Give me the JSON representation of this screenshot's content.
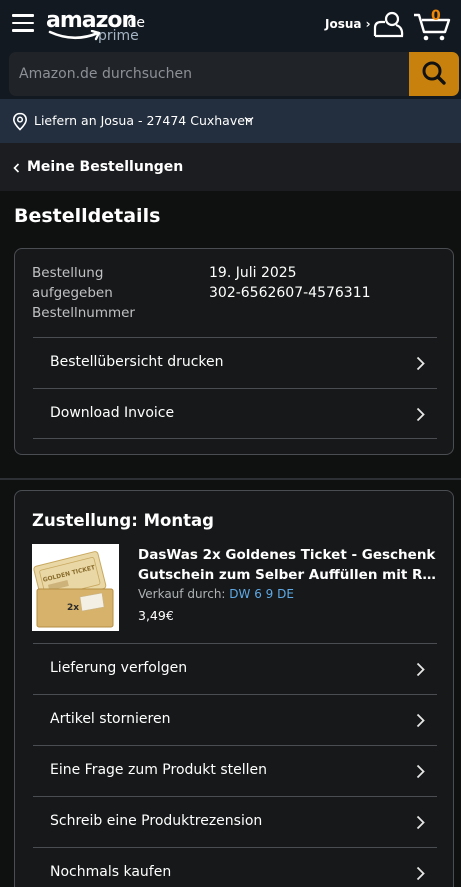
{
  "header": {
    "logo_text": "amazon",
    "logo_domain": ".de",
    "logo_sub": "prime",
    "account_label": "Josua ›",
    "cart_count": "0",
    "accent_color": "#c7810c"
  },
  "search": {
    "placeholder": "Amazon.de durchsuchen"
  },
  "delivery_bar": {
    "text": "Liefern an Josua - 27474 Cuxhaven"
  },
  "breadcrumb": {
    "label": "Meine Bestellungen"
  },
  "page": {
    "title": "Bestelldetails"
  },
  "order": {
    "placed_label_1": "Bestellung",
    "placed_label_2": "aufgegeben",
    "placed_value": "19. Juli 2025",
    "number_label": "Bestellnummer",
    "number_value": "302-6562607-4576311",
    "links": [
      "Bestellübersicht drucken",
      "Download Invoice"
    ]
  },
  "shipment": {
    "title": "Zustellung: Montag",
    "product_title_1": "DasWas 2x Goldenes Ticket - Geschenk",
    "product_title_2": "Gutschein zum Selber Auffüllen mit Rubbelfeld",
    "seller_prefix": "Verkauf durch: ",
    "seller_name": "DW 6 9 DE",
    "price": "3,49€",
    "ticket_text": "GOLDEN TICKET",
    "ticket_count": "2x",
    "actions": [
      "Lieferung verfolgen",
      "Artikel stornieren",
      "Eine Frage zum Produkt stellen",
      "Schreib eine Produktrezension",
      "Nochmals kaufen"
    ]
  }
}
